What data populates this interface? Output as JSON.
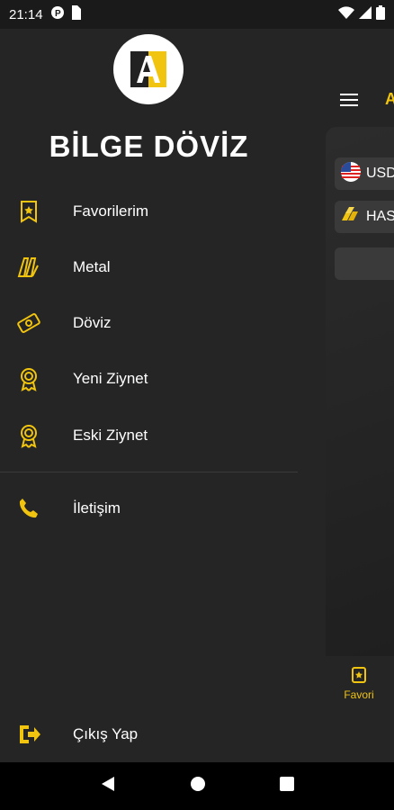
{
  "status": {
    "time": "21:14"
  },
  "app": {
    "title_fragment": "A",
    "chips": [
      {
        "label": "USD"
      },
      {
        "label": "HAS"
      }
    ],
    "bottom_tab": {
      "label": "Favori"
    }
  },
  "drawer": {
    "brand": "BİLGE DÖVİZ",
    "items": [
      {
        "label": "Favorilerim",
        "icon": "bookmark-star-icon"
      },
      {
        "label": "Metal",
        "icon": "gold-bars-icon"
      },
      {
        "label": "Döviz",
        "icon": "banknote-icon"
      },
      {
        "label": "Yeni Ziynet",
        "icon": "award-medal-icon"
      },
      {
        "label": "Eski Ziynet",
        "icon": "award-medal-icon"
      },
      {
        "label": "İletişim",
        "icon": "phone-icon"
      }
    ],
    "logout": {
      "label": "Çıkış Yap",
      "icon": "logout-icon"
    }
  },
  "colors": {
    "accent": "#F1C40F",
    "drawer_bg": "#252525",
    "text": "#FFFFFF"
  }
}
